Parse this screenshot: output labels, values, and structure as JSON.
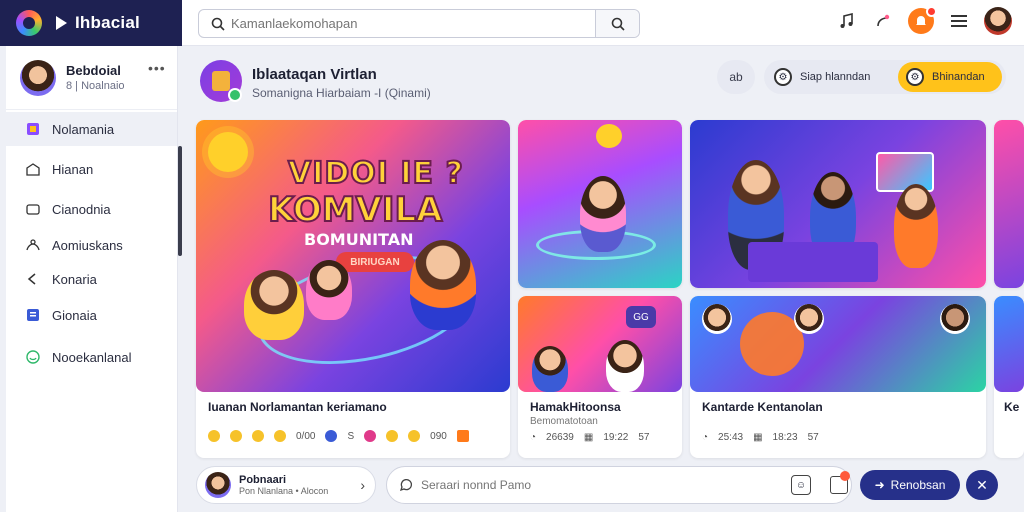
{
  "app": {
    "name": "Ihbacial"
  },
  "search": {
    "placeholder": "Kamanlaekomohapan"
  },
  "sidebar": {
    "profile": {
      "name": "Bebdoial",
      "sub": "8 | Noalnaio"
    },
    "items": [
      {
        "label": "Nolamania"
      },
      {
        "label": "Hianan"
      },
      {
        "label": "Cianodnia"
      },
      {
        "label": "Aomiuskans"
      },
      {
        "label": "Konaria"
      },
      {
        "label": "Gionaia"
      },
      {
        "label": "Nooekanlanal"
      }
    ]
  },
  "channel": {
    "title": "Iblaataqan Virtlan",
    "subtitle": "Somanigna Hiarbaiam -I (Qinami)"
  },
  "header_actions": {
    "round": "ab",
    "pill_a": "Siap hlanndan",
    "pill_b": "Bhinandan"
  },
  "cards": [
    {
      "title": "Iuanan Norlamantan keriamano",
      "meta": [
        "0/00",
        "S",
        "090"
      ],
      "thumb_h1": "VIDOI IE ?",
      "thumb_h2": "KOMVILA",
      "thumb_h3": "BOMUNITAN",
      "thumb_tag": "BIRIUGAN"
    },
    {
      "title": "HamakHitoonsa",
      "sub": "Bemomatotoan",
      "meta": [
        "26639",
        "19:22",
        "57"
      ]
    },
    {
      "title": "Kantarde Kentanolan",
      "meta": [
        "25:43",
        "18:23",
        "57"
      ]
    },
    {
      "title": "Ke"
    }
  ],
  "badges": {
    "card2_label": "GG"
  },
  "bottom": {
    "chip_title": "Pobnaari",
    "chip_sub": "Pon Nlanlana • Alocon",
    "comment_placeholder": "Seraari nonnd Pamo",
    "send_label": "Renobsan"
  },
  "colors": {
    "brand_bg": "#1e2152",
    "accent": "#ffc21a",
    "send": "#26308a"
  }
}
